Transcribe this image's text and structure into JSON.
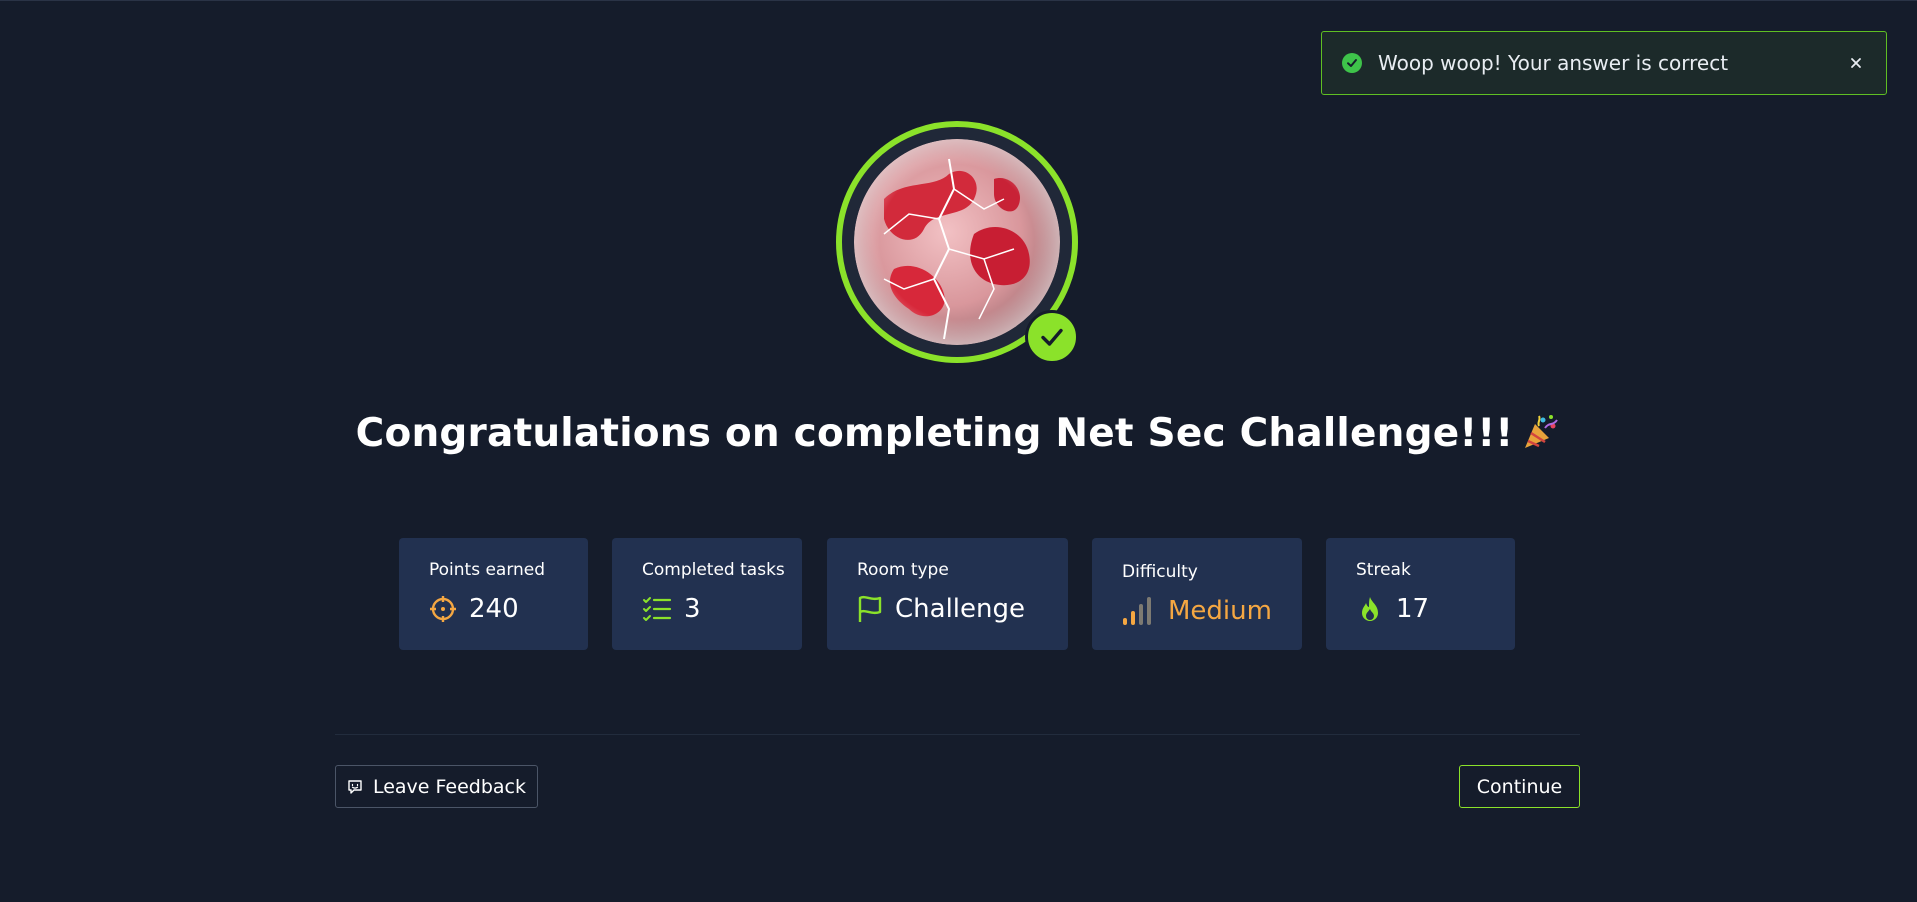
{
  "toast": {
    "message": "Woop woop! Your answer is correct",
    "close_label": "×",
    "accent": "#5fbf23"
  },
  "badge": {
    "ring_color": "#8be22a",
    "icon": "check-icon"
  },
  "title": {
    "text": "Congratulations on completing Net Sec Challenge!!!",
    "emoji": "party-popper-icon"
  },
  "stats": [
    {
      "label": "Points earned",
      "value": "240",
      "icon": "target-icon"
    },
    {
      "label": "Completed tasks",
      "value": "3",
      "icon": "checklist-icon"
    },
    {
      "label": "Room type",
      "value": "Challenge",
      "icon": "flag-icon"
    },
    {
      "label": "Difficulty",
      "value": "Medium",
      "icon": "signal-bars-icon",
      "color": "#f5a742"
    },
    {
      "label": "Streak",
      "value": "17",
      "icon": "flame-icon"
    }
  ],
  "actions": {
    "feedback_label": "Leave Feedback",
    "continue_label": "Continue"
  }
}
